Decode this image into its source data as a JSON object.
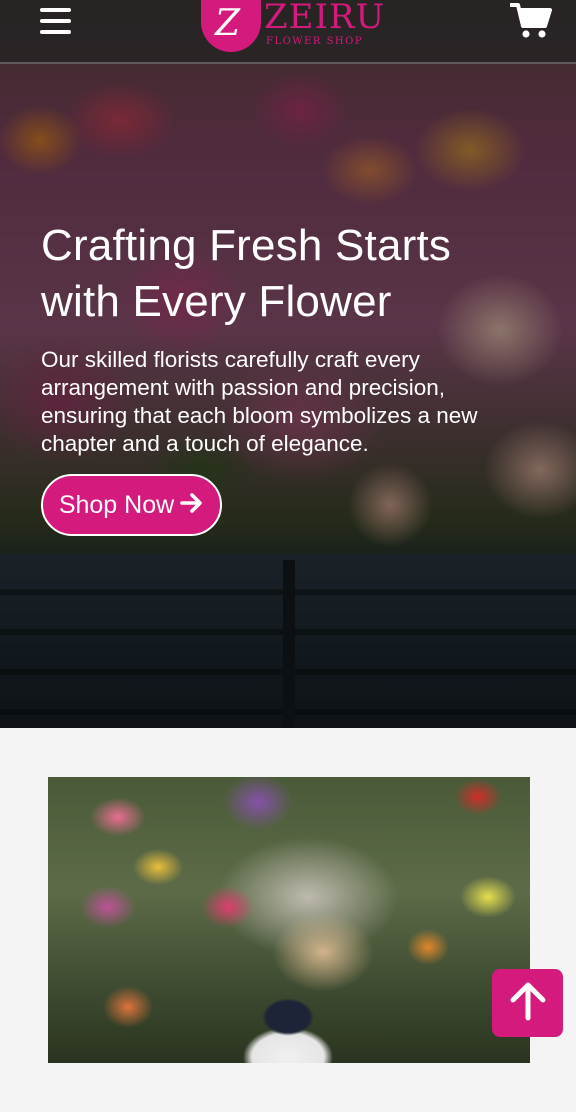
{
  "header": {
    "logo_name": "ZEIRU",
    "logo_subtitle": "FLOWER SHOP",
    "logo_letter": "Z",
    "menu_icon": "hamburger-menu-icon",
    "cart_icon": "shopping-cart-icon"
  },
  "hero": {
    "title": "Crafting Fresh Starts with Every Flower",
    "description": "Our skilled florists carefully craft every arrangement with passion and precision, ensuring that each bloom symbolizes a new chapter and a touch of elegance.",
    "cta_label": "Shop Now",
    "cta_icon": "arrow-right-icon"
  },
  "scroll_top": {
    "icon": "arrow-up-icon"
  },
  "colors": {
    "brand": "#d41a7c",
    "header_bg": "#232323",
    "page_bg": "#f4f4f4",
    "text_on_dark": "#ffffff"
  }
}
